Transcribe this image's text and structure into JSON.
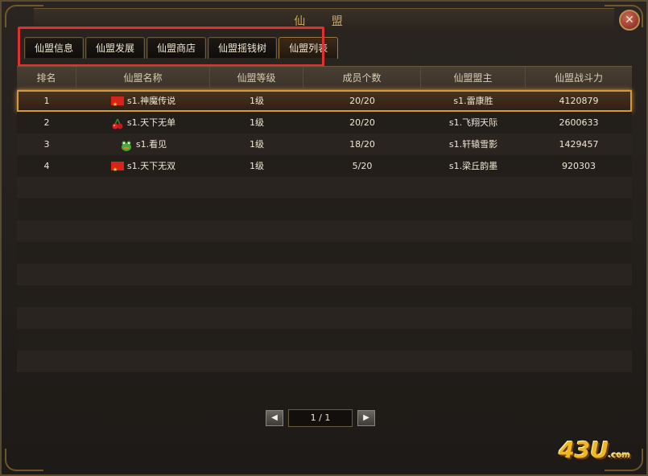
{
  "window": {
    "title": "仙 盟",
    "close_symbol": "✕"
  },
  "tabs": [
    {
      "label": "仙盟信息",
      "active": false
    },
    {
      "label": "仙盟发展",
      "active": false
    },
    {
      "label": "仙盟商店",
      "active": false
    },
    {
      "label": "仙盟摇钱树",
      "active": false
    },
    {
      "label": "仙盟列表",
      "active": true
    }
  ],
  "table": {
    "headers": [
      "排名",
      "仙盟名称",
      "仙盟等级",
      "成员个数",
      "仙盟盟主",
      "仙盟战斗力"
    ],
    "rows": [
      {
        "rank": "1",
        "icon": "china-flag-icon",
        "name": "s1.神魔传说",
        "level": "1级",
        "members": "20/20",
        "leader": "s1.雷康胜",
        "power": "4120879",
        "selected": true
      },
      {
        "rank": "2",
        "icon": "cherry-icon",
        "name": "s1.天下无单",
        "level": "1级",
        "members": "20/20",
        "leader": "s1.飞翔天际",
        "power": "2600633",
        "selected": false
      },
      {
        "rank": "3",
        "icon": "frog-icon",
        "name": "s1.看见",
        "level": "1级",
        "members": "18/20",
        "leader": "s1.轩辕雪影",
        "power": "1429457",
        "selected": false
      },
      {
        "rank": "4",
        "icon": "china-flag-icon",
        "name": "s1.天下无双",
        "level": "1级",
        "members": "5/20",
        "leader": "s1.梁丘韵墨",
        "power": "920303",
        "selected": false
      }
    ]
  },
  "pager": {
    "prev": "◀",
    "display": "1 / 1",
    "next": "▶"
  },
  "logo": {
    "main": "43U",
    "sub": ".com"
  },
  "colors": {
    "highlight": "#e03030",
    "selected_border": "#d49a3a",
    "accent": "#c9a45a"
  }
}
